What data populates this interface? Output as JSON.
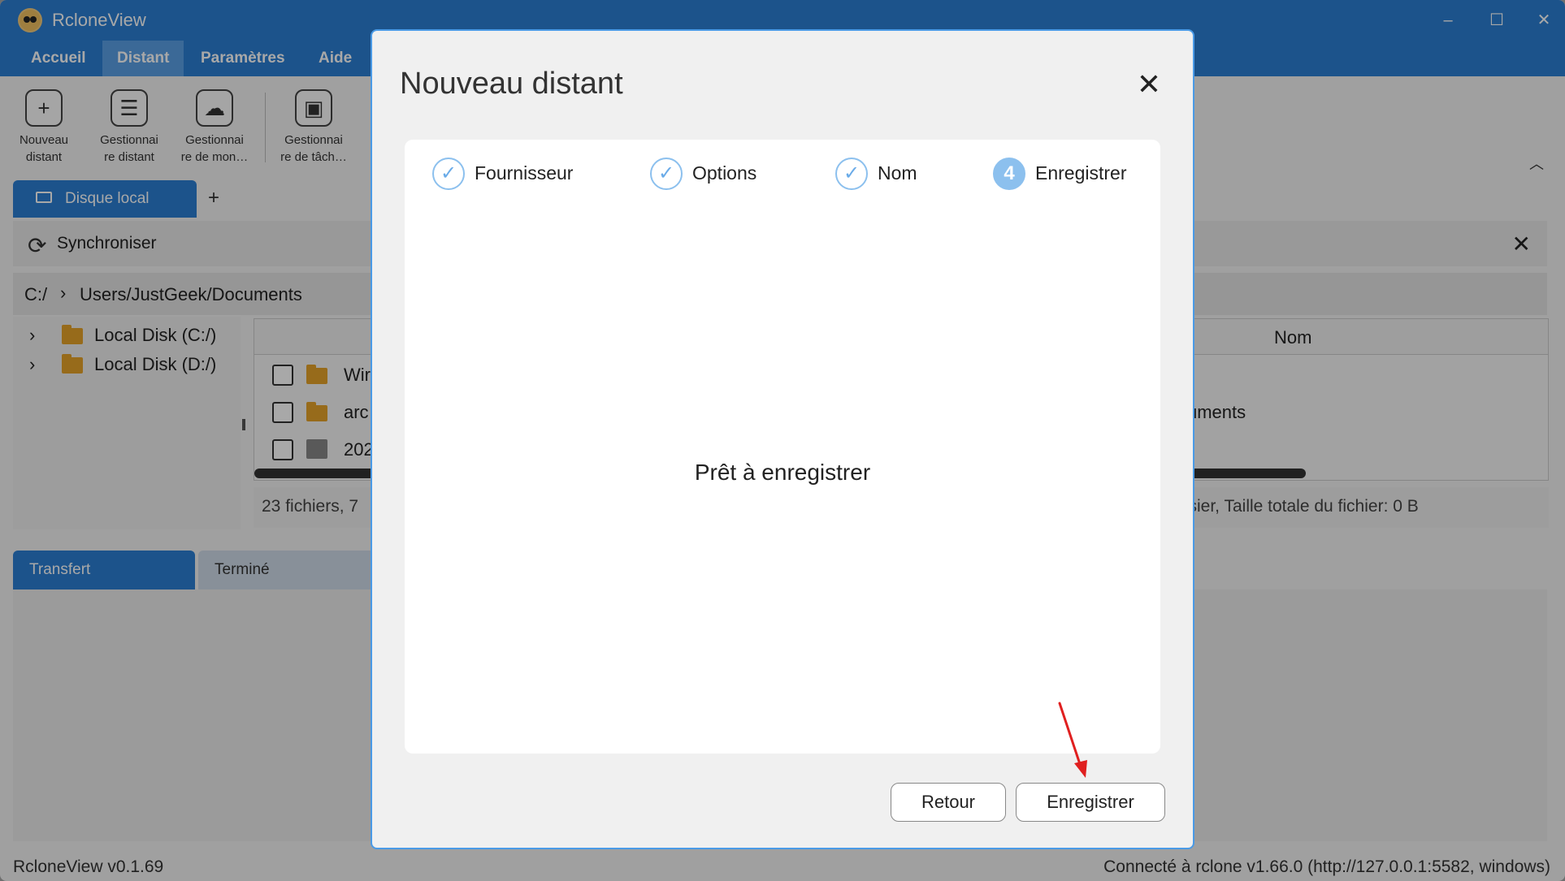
{
  "app": {
    "title": "RcloneView",
    "version": "RcloneView v0.1.69",
    "connection": "Connecté à rclone v1.66.0 (http://127.0.0.1:5582, windows)"
  },
  "menu": {
    "tabs": [
      {
        "label": "Accueil"
      },
      {
        "label": "Distant"
      },
      {
        "label": "Paramètres"
      },
      {
        "label": "Aide"
      }
    ]
  },
  "toolbar": {
    "items": [
      {
        "line1": "Nouveau",
        "line2": "distant",
        "icon": "plus-icon"
      },
      {
        "line1": "Gestionnai",
        "line2": "re distant",
        "icon": "server-list-icon"
      },
      {
        "line1": "Gestionnai",
        "line2": "re de mon…",
        "icon": "mount-cloud-icon"
      },
      {
        "line1": "Gestionnai",
        "line2": "re de tâch…",
        "icon": "briefcase-icon"
      }
    ]
  },
  "explorer": {
    "tab_label": "Disque local",
    "add_tab": "+",
    "sync_label": "Synchroniser",
    "path_drive": "C:/",
    "path": "Users/JustGeek/Documents",
    "tree": [
      {
        "label": "Local Disk (C:/)"
      },
      {
        "label": "Local Disk (D:/)"
      }
    ],
    "columns": {
      "name": "Nom"
    },
    "rows": [
      {
        "name": "Wir",
        "type": "folder"
      },
      {
        "name": "arc",
        "type": "folder"
      },
      {
        "name": "202",
        "type": "image"
      }
    ],
    "right_row_text": "uments",
    "status_left": "23 fichiers, 7",
    "status_right": "ssier, Taille totale du fichier: 0 B"
  },
  "transfer": {
    "tabs": [
      {
        "label": "Transfert"
      },
      {
        "label": "Terminé"
      }
    ]
  },
  "dialog": {
    "title": "Nouveau distant",
    "steps": [
      {
        "label": "Fournisseur",
        "state": "done"
      },
      {
        "label": "Options",
        "state": "done"
      },
      {
        "label": "Nom",
        "state": "done"
      },
      {
        "label": "Enregistrer",
        "state": "current",
        "number": "4"
      }
    ],
    "message": "Prêt à enregistrer",
    "back_label": "Retour",
    "save_label": "Enregistrer"
  },
  "colors": {
    "accent": "#2b7fd4",
    "step_accent": "#8cc0ee",
    "annotation_arrow": "#e02020"
  }
}
